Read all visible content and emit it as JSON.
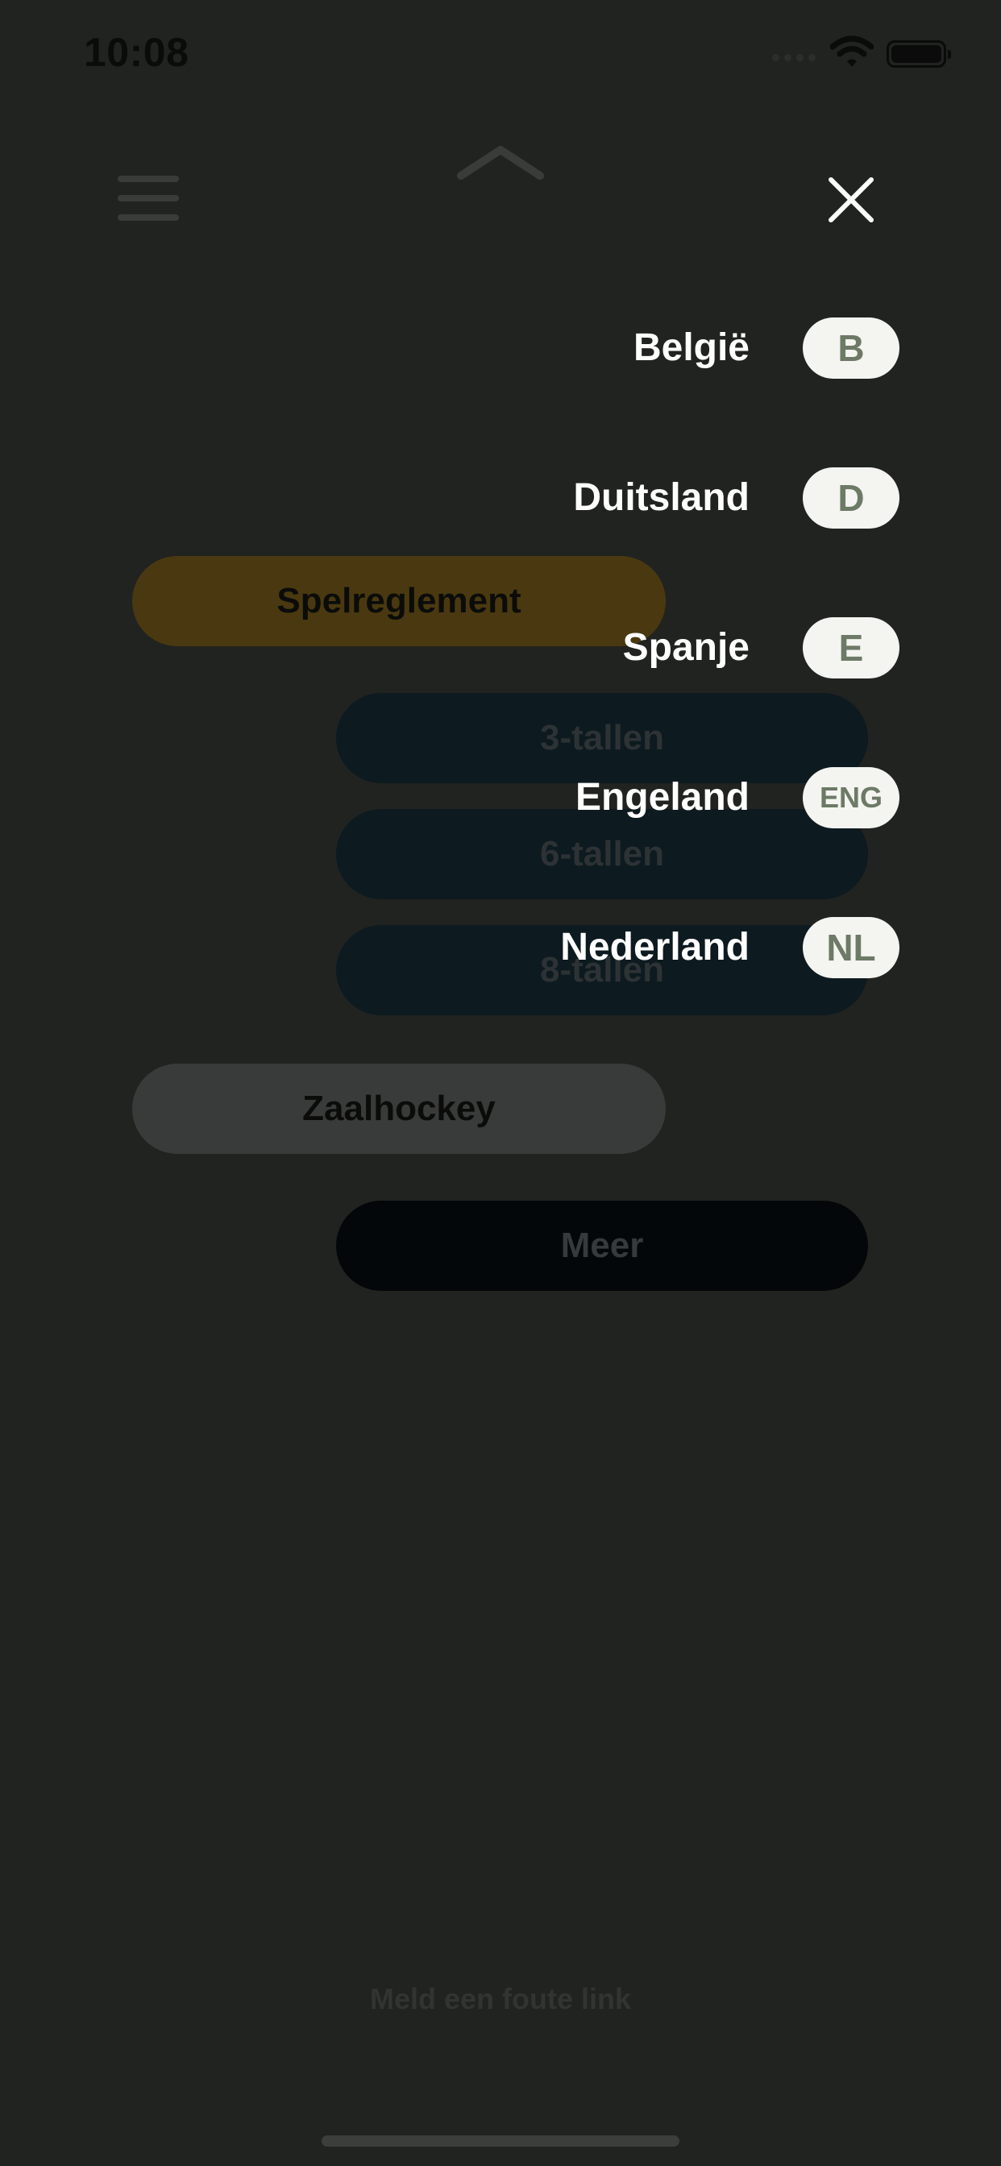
{
  "status_bar": {
    "time": "10:08"
  },
  "main_menu": {
    "spelreglement": "Spelreglement",
    "sub_items": [
      "3-tallen",
      "6-tallen",
      "8-tallen"
    ],
    "zaalhockey": "Zaalhockey",
    "meer": "Meer"
  },
  "footer": {
    "report_link": "Meld een foute link"
  },
  "language_menu": {
    "items": [
      {
        "label": "België",
        "code": "B"
      },
      {
        "label": "Duitsland",
        "code": "D"
      },
      {
        "label": "Spanje",
        "code": "E"
      },
      {
        "label": "Engeland",
        "code": "ENG"
      },
      {
        "label": "Nederland",
        "code": "NL"
      }
    ]
  },
  "colors": {
    "overlay_background": "#212320",
    "badge_background": "#f4f4f0",
    "badge_text": "#6d7a66",
    "label_text": "#ffffff"
  }
}
